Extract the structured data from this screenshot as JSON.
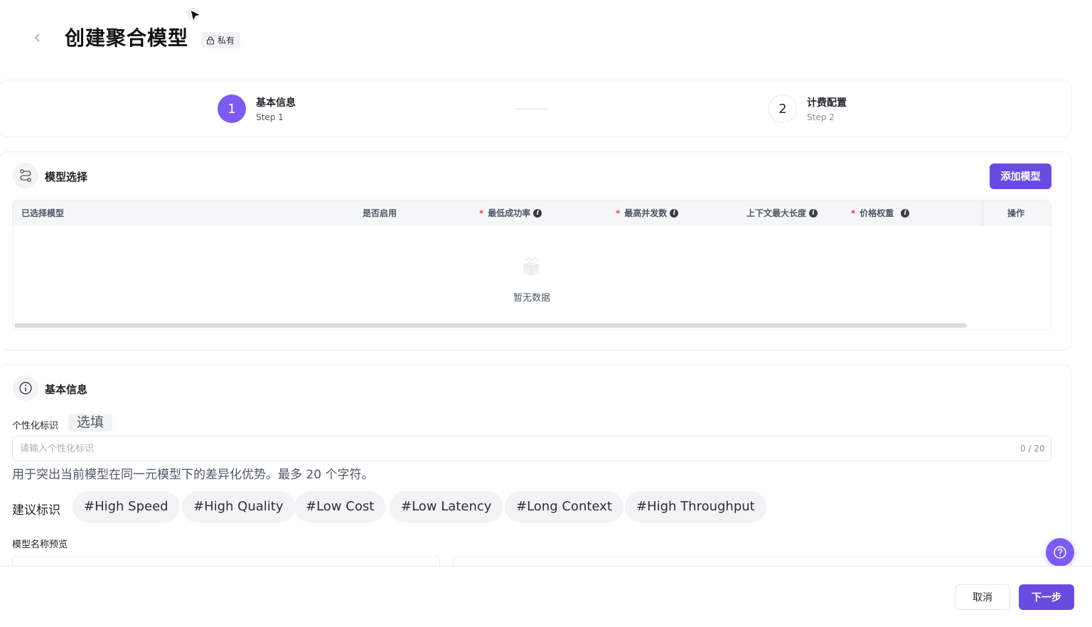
{
  "header": {
    "title": "创建聚合模型",
    "private_tag": "私有"
  },
  "steps": [
    {
      "number": "1",
      "title": "基本信息",
      "subtitle": "Step 1",
      "active": true
    },
    {
      "number": "2",
      "title": "计费配置",
      "subtitle": "Step 2",
      "active": false
    }
  ],
  "model_section": {
    "title": "模型选择",
    "add_button": "添加模型",
    "columns": {
      "selected_model": "已选择模型",
      "enabled": "是否启用",
      "min_success_rate": "最低成功率",
      "max_concurrency": "最高并发数",
      "max_context": "上下文最大长度",
      "price_weight": "价格权重",
      "actions": "操作"
    },
    "empty_text": "暂无数据"
  },
  "basic_section": {
    "title": "基本信息",
    "tag_label": "个性化标识",
    "optional": "选填",
    "input_placeholder": "请输入个性化标识",
    "input_value": "",
    "counter": "0 / 20",
    "help": "用于突出当前模型在同一元模型下的差异化优势。最多 20 个字符。",
    "suggest_label": "建议标识",
    "suggestions": [
      "#High Speed",
      "#High Quality",
      "#Low Cost",
      "#Low Latency",
      "#Long Context",
      "#High Throughput"
    ],
    "preview_label": "模型名称预览"
  },
  "footer": {
    "cancel": "取消",
    "next": "下一步"
  },
  "colors": {
    "primary": "#6a4be0",
    "step_active": "#7c5cf0",
    "required": "#e5484d"
  },
  "icons": {
    "back": "chevron-left-icon",
    "lock": "lock-icon",
    "models": "route-icon",
    "info": "info-circle-icon",
    "help": "question-circle-icon"
  }
}
